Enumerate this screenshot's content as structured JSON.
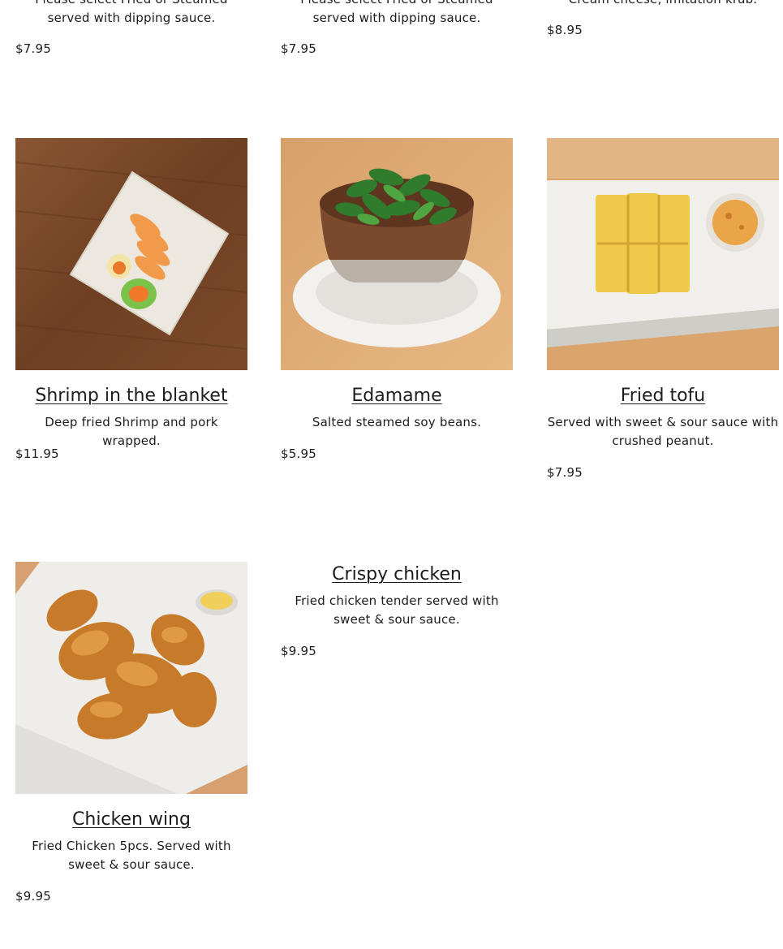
{
  "top_row": [
    {
      "description": "Please select Fried or Steamed served with dipping sauce.",
      "price": "$7.95"
    },
    {
      "description": "Please select Fried or Steamed served with dipping sauce.",
      "price": "$7.95"
    },
    {
      "description": "Cream cheese, imitation krab.",
      "price": "$8.95"
    }
  ],
  "items": [
    {
      "name": "Shrimp in the blanket",
      "description": "Deep fried Shrimp and pork wrapped.",
      "price": "$11.95",
      "image": "shrimp-in-the-blanket-photo"
    },
    {
      "name": "Edamame",
      "description": "Salted steamed soy beans.",
      "price": "$5.95",
      "image": "edamame-photo"
    },
    {
      "name": "Fried tofu",
      "description": "Served with sweet & sour sauce with crushed peanut.",
      "price": "$7.95",
      "image": "fried-tofu-photo"
    },
    {
      "name": "Chicken wing",
      "description": "Fried Chicken 5pcs. Served with sweet & sour sauce.",
      "price": "$9.95",
      "image": "chicken-wing-photo"
    },
    {
      "name": "Crispy chicken",
      "description": "Fried chicken tender served with sweet & sour sauce.",
      "price": "$9.95"
    }
  ]
}
